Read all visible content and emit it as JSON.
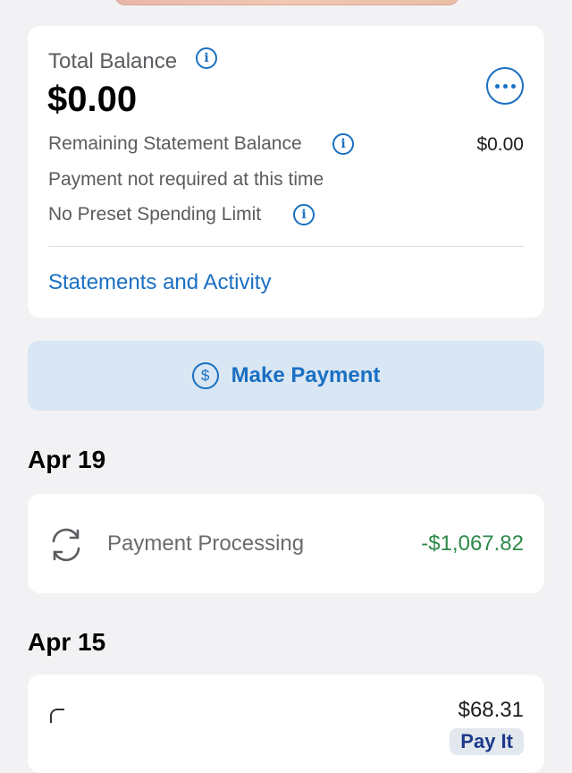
{
  "balance": {
    "total_label": "Total Balance",
    "total_value": "$0.00",
    "remaining_label": "Remaining Statement Balance",
    "remaining_value": "$0.00",
    "payment_note": "Payment not required at this time",
    "limit_note": "No Preset Spending Limit",
    "statements_link": "Statements and Activity"
  },
  "payment": {
    "button_label": "Make Payment",
    "dollar_symbol": "$"
  },
  "activity": {
    "groups": [
      {
        "date": "Apr 19",
        "transactions": [
          {
            "name": "Payment Processing",
            "amount": "-$1,067.82"
          }
        ]
      },
      {
        "date": "Apr 15",
        "transactions": [
          {
            "amount": "$68.31",
            "action": "Pay It"
          }
        ]
      }
    ]
  },
  "icons": {
    "info": "i",
    "more": "ellipsis-icon",
    "refresh": "refresh-icon"
  },
  "colors": {
    "accent": "#1a6fc2",
    "credit": "#2e8a4a",
    "background": "#f2f2f4"
  }
}
